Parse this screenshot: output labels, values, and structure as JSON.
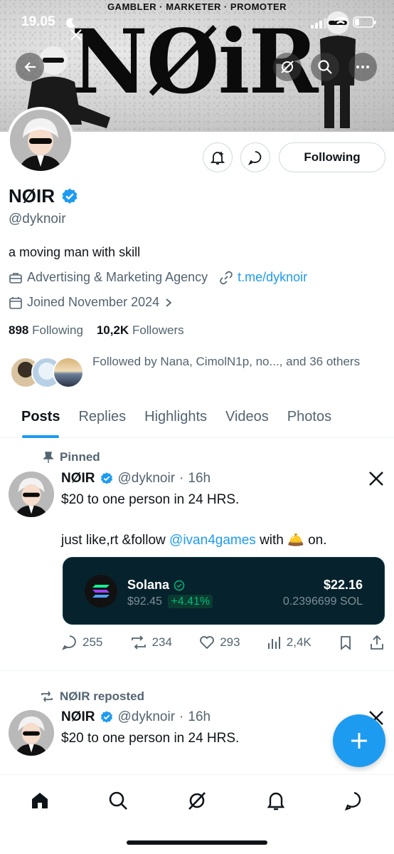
{
  "status_bar": {
    "time": "19.05"
  },
  "banner": {
    "tagline": "GAMBLER · MARKETER · PROMOTER",
    "logo_text": "NØiR"
  },
  "profile": {
    "display_name": "NØIR",
    "handle": "@dyknoir",
    "bio": "a moving man with skill",
    "category": "Advertising & Marketing Agency",
    "link": "t.me/dyknoir",
    "joined": "Joined November 2024",
    "following_count": "898",
    "following_label": "Following",
    "followers_count": "10,2K",
    "followers_label": "Followers",
    "followed_by": "Followed by Nana, CimolN1p, no..., and 36 others",
    "follow_button_label": "Following"
  },
  "tabs": [
    {
      "label": "Posts",
      "active": true
    },
    {
      "label": "Replies"
    },
    {
      "label": "Highlights"
    },
    {
      "label": "Videos"
    },
    {
      "label": "Photos"
    }
  ],
  "tweets": [
    {
      "pinned_label": "Pinned",
      "name": "NØIR",
      "handle": "@dyknoir",
      "time": "16h",
      "line1": "$20 to one person in 24 HRS.",
      "line2_pre": "just like,rt &follow ",
      "mention": "@ivan4games",
      "line2_mid": " with ",
      "line2_emoji": "🛎️",
      "line2_post": " on.",
      "card": {
        "name": "Solana",
        "price": "$92.45",
        "change": "+4.41%",
        "value": "$22.16",
        "amount": "0.2396699 SOL"
      },
      "replies": "255",
      "reposts": "234",
      "likes": "293",
      "views": "2,4K"
    },
    {
      "repost_label": "NØIR reposted",
      "name": "NØIR",
      "handle": "@dyknoir",
      "time": "16h",
      "line1": "$20 to one person in 24 HRS."
    }
  ],
  "colors": {
    "accent": "#1d9bf0",
    "text": "#0f1419",
    "secondary": "#536471",
    "card_bg": "#06222c",
    "positive": "#00ba7c"
  }
}
